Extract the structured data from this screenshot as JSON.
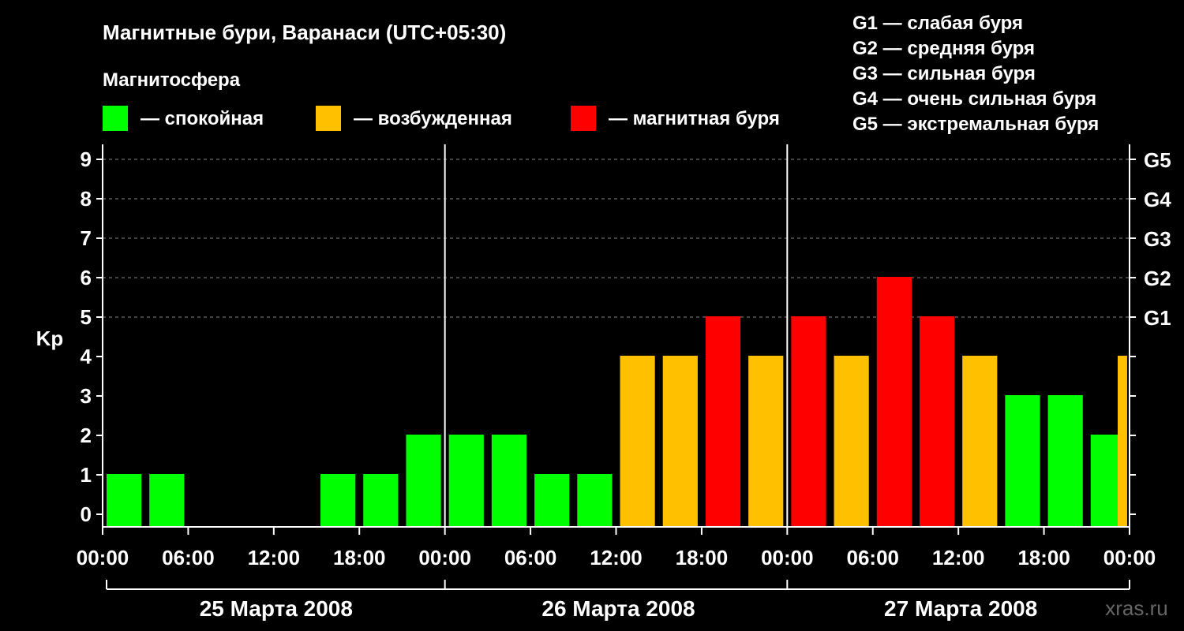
{
  "chart_data": {
    "type": "bar",
    "title": "Магнитные бури, Варанаси (UTC+05:30)",
    "ylabel": "Kp",
    "ylim": [
      0,
      9
    ],
    "yticks": [
      "0",
      "1",
      "2",
      "3",
      "4",
      "5",
      "6",
      "7",
      "8",
      "9"
    ],
    "g_levels": [
      {
        "kp": 5,
        "label": "G1"
      },
      {
        "kp": 6,
        "label": "G2"
      },
      {
        "kp": 7,
        "label": "G3"
      },
      {
        "kp": 8,
        "label": "G4"
      },
      {
        "kp": 9,
        "label": "G5"
      }
    ],
    "g_legend": [
      "G1 — слабая буря",
      "G2 — средняя буря",
      "G3 — сильная буря",
      "G4 — очень сильная буря",
      "G5 — экстремальная буря"
    ],
    "legend_title": "Магнитосфера",
    "legend": [
      {
        "label": "— спокойная",
        "color": "#00ff00"
      },
      {
        "label": "— возбужденная",
        "color": "#ffc000"
      },
      {
        "label": "— магнитная буря",
        "color": "#ff0000"
      }
    ],
    "x_tick_labels": [
      "00:00",
      "06:00",
      "12:00",
      "18:00",
      "00:00",
      "06:00",
      "12:00",
      "18:00",
      "00:00",
      "06:00",
      "12:00",
      "18:00",
      "00:00"
    ],
    "days": [
      "25 Марта 2008",
      "26 Марта 2008",
      "27 Марта 2008"
    ],
    "bar_hours": [
      0,
      3,
      6,
      9,
      12,
      15,
      18,
      21,
      24,
      27,
      30,
      33,
      36,
      39,
      42,
      45,
      48,
      51,
      54,
      57,
      60,
      63,
      66,
      69
    ],
    "values": [
      1,
      1,
      0,
      0,
      0,
      1,
      1,
      2,
      2,
      2,
      1,
      1,
      4,
      4,
      5,
      4,
      5,
      4,
      6,
      5,
      4,
      3,
      3,
      2
    ],
    "partial_last": {
      "hour": 72,
      "value": 4
    },
    "colors": {
      "quiet": "#00ff00",
      "active": "#ffc000",
      "storm": "#ff0000",
      "grid": "#888888",
      "axis": "#ffffff"
    },
    "grid": true,
    "legend_position": "top"
  },
  "watermark": "xras.ru"
}
